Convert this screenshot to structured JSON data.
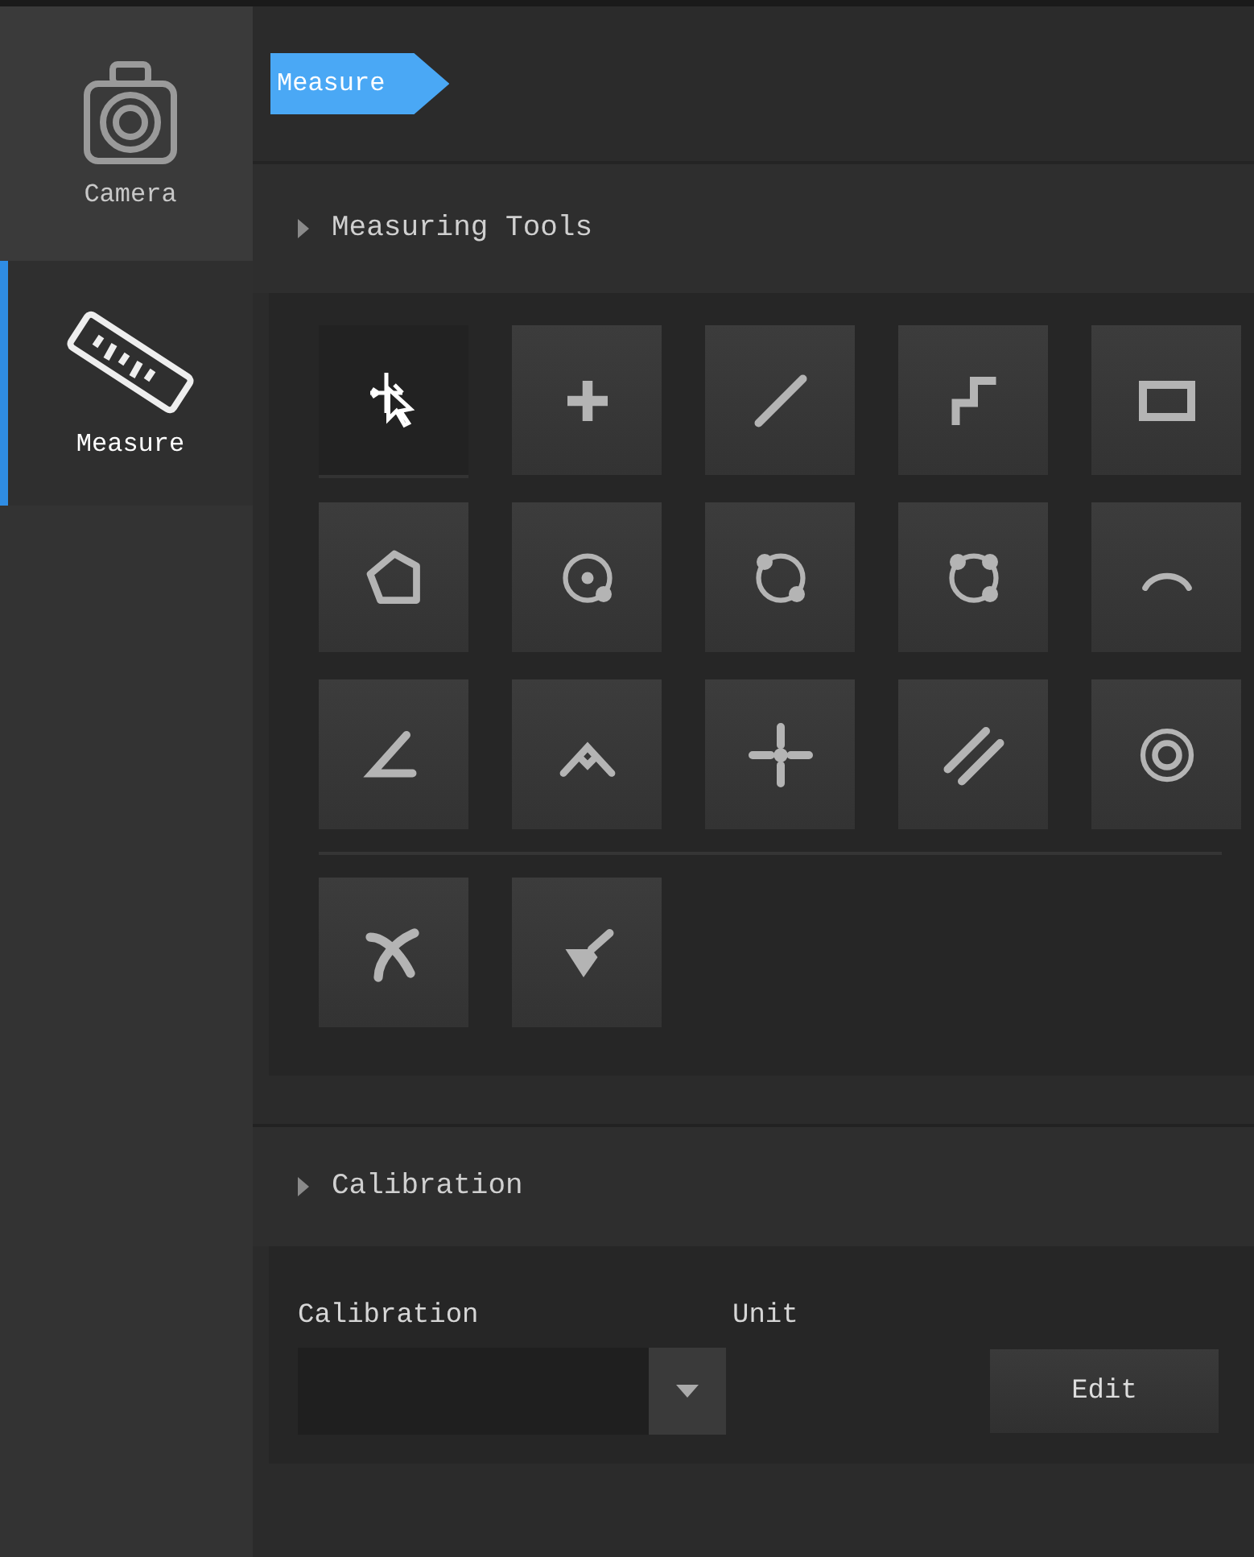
{
  "sidebar": {
    "items": [
      {
        "label": "Camera",
        "kind": "camera",
        "selected": false
      },
      {
        "label": "Measure",
        "kind": "ruler",
        "selected": true
      }
    ]
  },
  "breadcrumb": "Measure",
  "measuring_tools": {
    "title": "Measuring Tools",
    "groups": [
      [
        {
          "kind": "select",
          "selected": true
        },
        {
          "kind": "point",
          "selected": false
        },
        {
          "kind": "line",
          "selected": false
        },
        {
          "kind": "polyline",
          "selected": false
        },
        {
          "kind": "rectangle",
          "selected": false
        },
        {
          "kind": "polygon",
          "selected": false
        },
        {
          "kind": "circle-center",
          "selected": false
        },
        {
          "kind": "circle-2pt",
          "selected": false
        },
        {
          "kind": "circle-3pt",
          "selected": false
        },
        {
          "kind": "arc",
          "selected": false
        },
        {
          "kind": "angle",
          "selected": false
        },
        {
          "kind": "angle-right",
          "selected": false
        },
        {
          "kind": "crosshair",
          "selected": false
        },
        {
          "kind": "parallel",
          "selected": false
        },
        {
          "kind": "concentric",
          "selected": false
        }
      ],
      [
        {
          "kind": "delete",
          "selected": false
        },
        {
          "kind": "clear",
          "selected": false
        }
      ]
    ]
  },
  "calibration": {
    "title": "Calibration",
    "calibration_label": "Calibration",
    "unit_label": "Unit",
    "edit_button": "Edit"
  }
}
